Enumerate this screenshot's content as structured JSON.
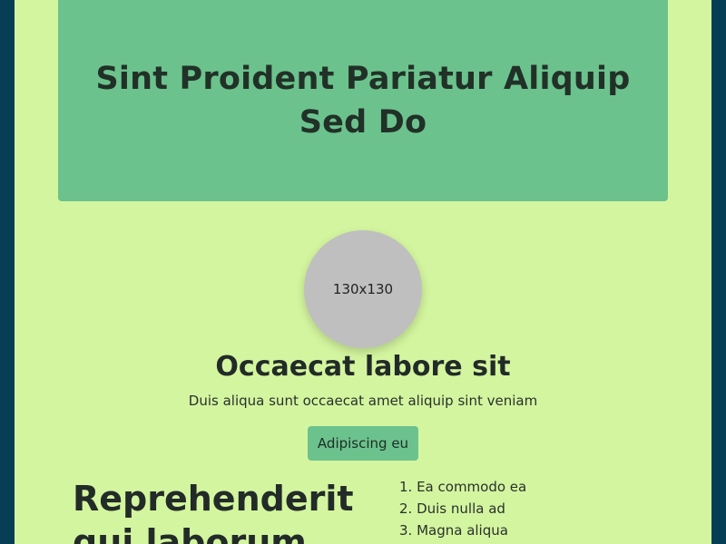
{
  "hero": {
    "title": "Sint Proident Pariatur Aliquip Sed Do"
  },
  "profile": {
    "avatar_text": "130x130",
    "name": "Occaecat labore sit",
    "description": "Duis aliqua sunt occaecat amet aliquip sint veniam",
    "button_label": "Adipiscing eu"
  },
  "section": {
    "title": "Reprehenderit qui laborum",
    "items": [
      "1. Ea commodo ea",
      "2. Duis nulla ad",
      "3. Magna aliqua"
    ]
  }
}
